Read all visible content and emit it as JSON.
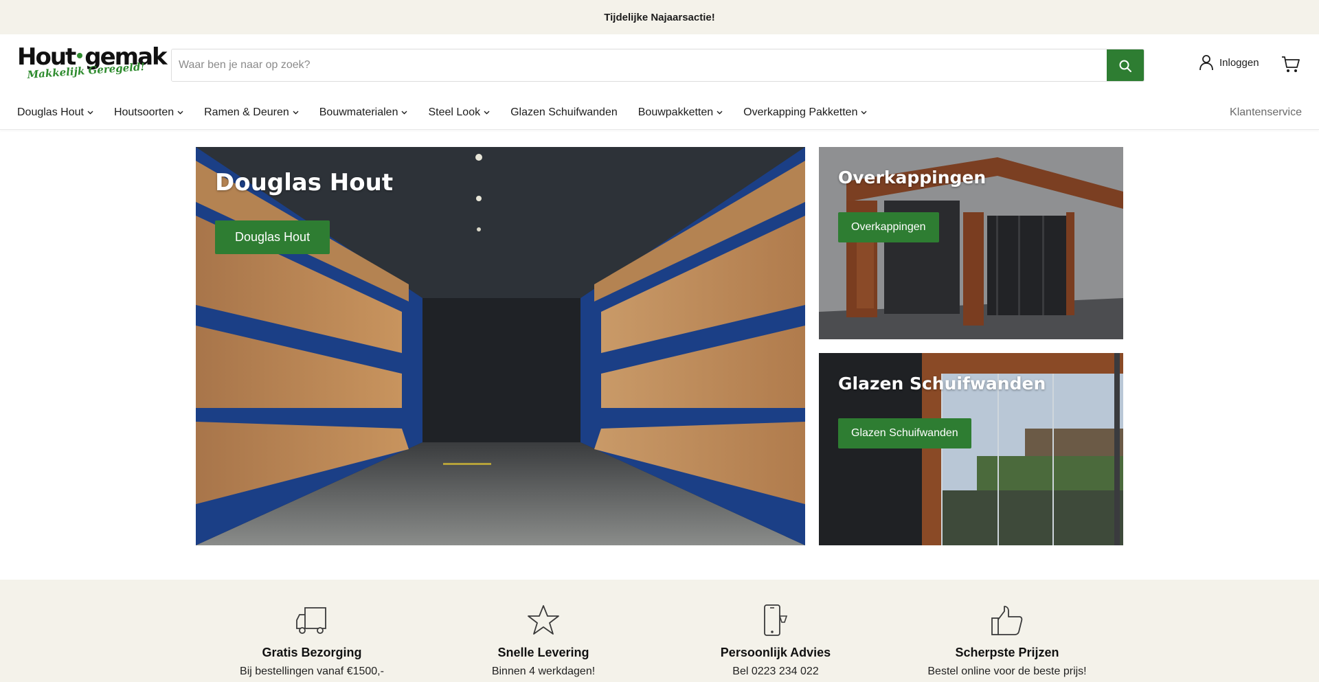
{
  "announcement": "Tijdelijke Najaarsactie!",
  "logo": {
    "brand_left": "Hout",
    "brand_right": "gemak",
    "slogan": "Makkelijk Geregeld!"
  },
  "search": {
    "placeholder": "Waar ben je naar op zoek?",
    "value": "",
    "icon": "search-icon"
  },
  "account": {
    "login_label": "Inloggen",
    "icon": "user-icon"
  },
  "cart": {
    "icon": "cart-icon"
  },
  "nav": {
    "items": [
      {
        "label": "Douglas Hout",
        "has_dropdown": true
      },
      {
        "label": "Houtsoorten",
        "has_dropdown": true
      },
      {
        "label": "Ramen & Deuren",
        "has_dropdown": true
      },
      {
        "label": "Bouwmaterialen",
        "has_dropdown": true
      },
      {
        "label": "Steel Look",
        "has_dropdown": true
      },
      {
        "label": "Glazen Schuifwanden",
        "has_dropdown": false
      },
      {
        "label": "Bouwpakketten",
        "has_dropdown": true
      },
      {
        "label": "Overkapping Pakketten",
        "has_dropdown": true
      }
    ],
    "service": "Klantenservice"
  },
  "hero": {
    "main": {
      "title": "Douglas Hout",
      "button": "Douglas Hout"
    },
    "top": {
      "title": "Overkappingen",
      "button": "Overkappingen"
    },
    "bottom": {
      "title": "Glazen Schuifwanden",
      "button": "Glazen Schuifwanden"
    }
  },
  "features": [
    {
      "icon": "truck-icon",
      "title": "Gratis Bezorging",
      "subtitle": "Bij bestellingen vanaf €1500,-"
    },
    {
      "icon": "star-icon",
      "title": "Snelle Levering",
      "subtitle": "Binnen 4 werkdagen!"
    },
    {
      "icon": "phone-icon",
      "title": "Persoonlijk Advies",
      "subtitle": "Bel 0223 234 022"
    },
    {
      "icon": "thumbs-up-icon",
      "title": "Scherpste Prijzen",
      "subtitle": "Bestel online voor de beste prijs!"
    }
  ],
  "colors": {
    "accent": "#2e7d32",
    "announcement_bg": "#f4f2ea",
    "text": "#1c1c1c"
  }
}
